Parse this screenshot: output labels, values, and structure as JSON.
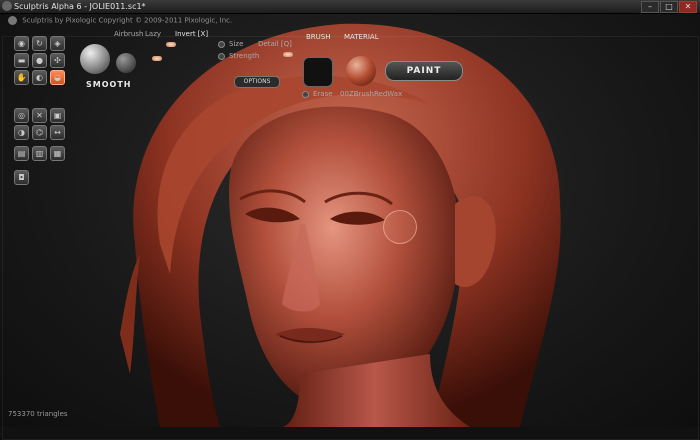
{
  "window": {
    "title": "Sculptris Alpha 6 - JOLIE011.sc1*",
    "controls": [
      "minimize",
      "maximize",
      "close"
    ],
    "control_glyphs": [
      "–",
      "□",
      "✕"
    ]
  },
  "info_bar": {
    "text": "Sculptris by Pixologic   Copyright © 2009-2011 Pixologic, Inc."
  },
  "brush_panel": {
    "active_brush_label": "SMOOTH",
    "airbrush_label": "Airbrush",
    "lazy_label": "Lazy",
    "invert_label": "Invert [X]",
    "size_label": "Size",
    "strength_label": "Strength",
    "detail_label": "Detail [Q]",
    "options_label": "OPTIONS"
  },
  "brush_section": {
    "title": "BRUSH",
    "erase_label": "Erase",
    "brush_name": "00ZBrush"
  },
  "material_section": {
    "title": "MATERIAL",
    "material_name": "RedWax"
  },
  "paint_button": "PAINT",
  "status": {
    "triangles": "753370 triangles"
  },
  "colors": {
    "model_skin": "#b2503c",
    "model_highlight": "#e59580",
    "model_shadow": "#4a140b",
    "accent_active_tool": "#e86a35",
    "background": "#1a1a1a"
  },
  "tool_icons": [
    "draw-icon",
    "rotate-icon",
    "crease-icon",
    "flatten-icon",
    "inflate-icon",
    "pinch-icon",
    "grab-icon",
    "smooth-icon",
    "scale-icon",
    "reduce-icon",
    "mask-icon",
    "transform-icon",
    "symmetry-icon",
    "wireframe-icon",
    "import-icon",
    "save-icon",
    "new-sphere-icon",
    "new-plane-icon",
    "camera-icon"
  ]
}
